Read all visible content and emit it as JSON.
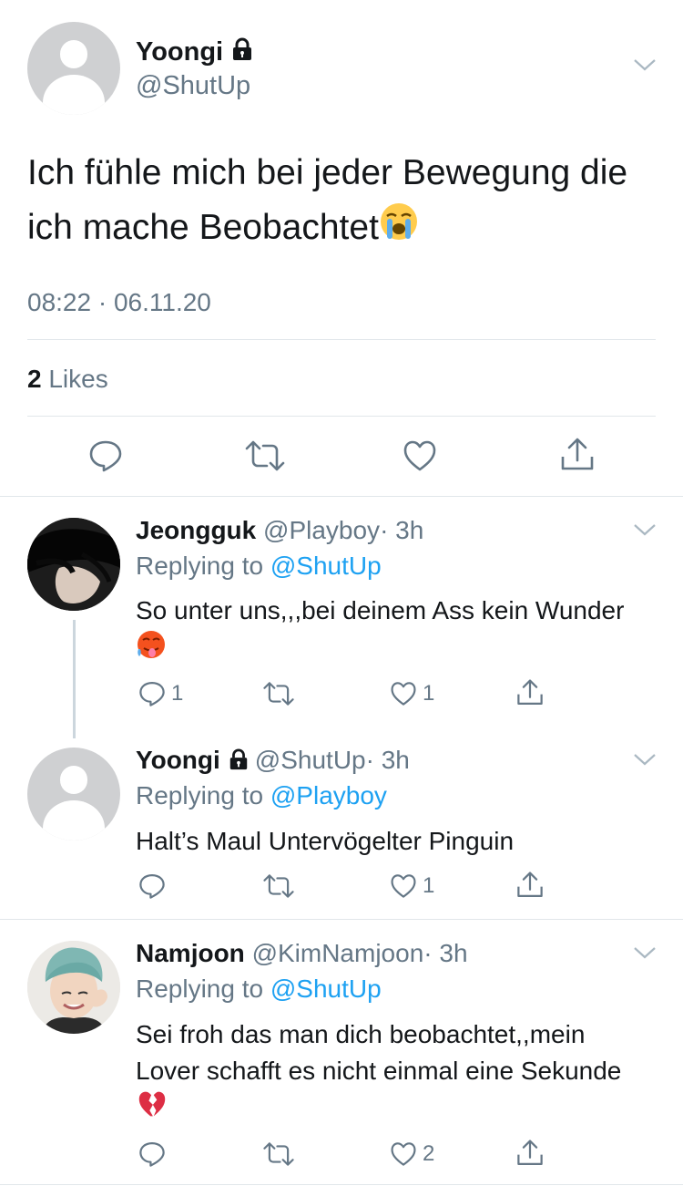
{
  "main_tweet": {
    "name": "Yoongi",
    "handle": "@ShutUp",
    "text": "Ich fühle mich bei jeder Bewegung die ich mache Beobachtet",
    "emoji": "loudly-crying-face",
    "timestamp": "08:22 · 06.11.20",
    "likes_count": "2",
    "likes_label": "Likes"
  },
  "replies": [
    {
      "name": "Jeongguk",
      "handle": "@Playboy",
      "time": "· 3h",
      "replying_label": "Replying to",
      "replying_to": "@ShutUp",
      "text": "So unter uns,,,bei deinem Ass kein Wunder",
      "emoji": "hot-face",
      "reply_count": "1",
      "like_count": "1"
    },
    {
      "name": "Yoongi",
      "handle": "@ShutUp",
      "time": "· 3h",
      "replying_label": "Replying to",
      "replying_to": "@Playboy",
      "text": "Halt’s Maul Untervögelter Pinguin",
      "reply_count": "",
      "like_count": "1"
    },
    {
      "name": "Namjoon",
      "handle": "@KimNamjoon",
      "time": "· 3h",
      "replying_label": "Replying to",
      "replying_to": "@ShutUp",
      "text": "Sei froh das man dich beobachtet,,mein Lover schafft es nicht einmal eine Sekunde",
      "emoji": "broken-heart",
      "reply_count": "",
      "like_count": "2"
    }
  ],
  "colors": {
    "accent": "#1da1f2",
    "grey": "#657786",
    "divider": "#e1e6ea"
  }
}
